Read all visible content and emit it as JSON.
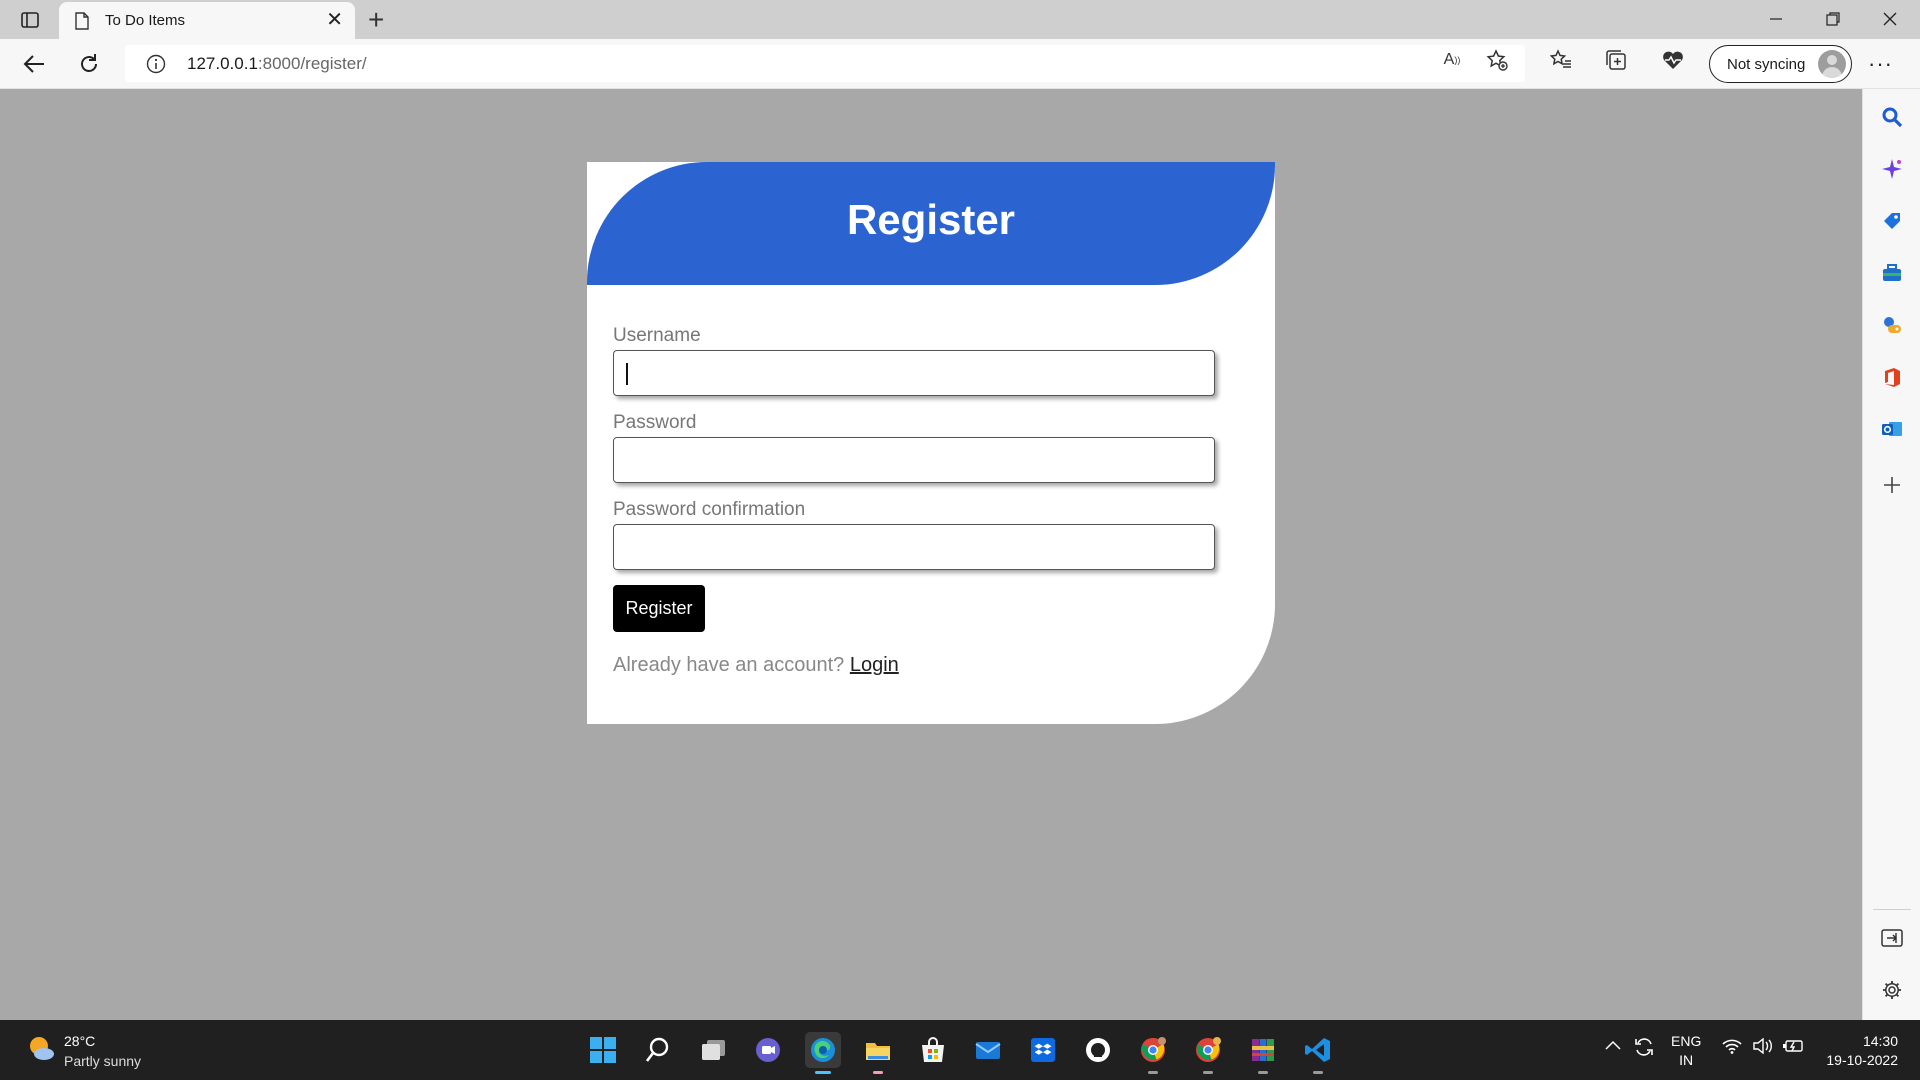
{
  "browser": {
    "tab_title": "To Do Items",
    "url_host": "127.0.0.1",
    "url_rest": ":8000/register/",
    "sync_label": "Not syncing"
  },
  "page": {
    "title": "Register",
    "fields": [
      {
        "label": "Username",
        "value": ""
      },
      {
        "label": "Password",
        "value": ""
      },
      {
        "label": "Password confirmation",
        "value": ""
      }
    ],
    "submit_label": "Register",
    "login_prompt": "Already have an account?",
    "login_link": "Login",
    "colors": {
      "header": "#2b63d1",
      "background": "#a9a8a9",
      "button": "#000000"
    }
  },
  "taskbar": {
    "weather_temp": "28°C",
    "weather_condition": "Partly sunny",
    "lang_top": "ENG",
    "lang_bottom": "IN",
    "time": "14:30",
    "date": "19-10-2022"
  }
}
